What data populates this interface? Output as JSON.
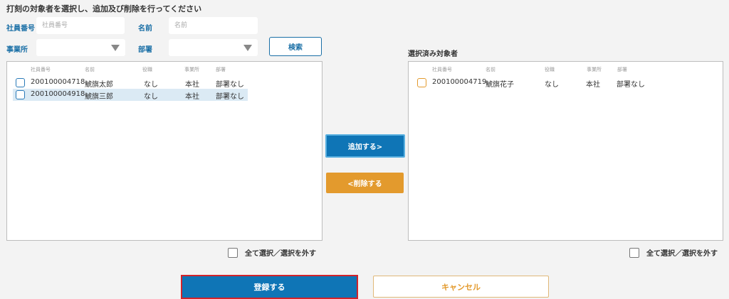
{
  "instruction": "打刻の対象者を選択し、追加及び削除を行ってください",
  "filters": {
    "employee_no_label": "社員番号",
    "employee_no_placeholder": "社員番号",
    "name_label": "名前",
    "name_placeholder": "名前",
    "office_label": "事業所",
    "office_value": "",
    "department_label": "部署",
    "department_value": "",
    "search_label": "検索"
  },
  "left_panel": {
    "columns": [
      "社員番号",
      "名前",
      "役職",
      "事業所",
      "部署"
    ],
    "rows": [
      {
        "employee_no": "200100004718",
        "name": "鯱旗太郎",
        "position": "なし",
        "office": "本社",
        "department": "部署なし",
        "checked": false,
        "highlighted": false
      },
      {
        "employee_no": "200100004918",
        "name": "鯱旗三郎",
        "position": "なし",
        "office": "本社",
        "department": "部署なし",
        "checked": false,
        "highlighted": true
      }
    ],
    "select_all_label": "全て選択／選択を外す"
  },
  "right_panel": {
    "title": "選択済み対象者",
    "columns": [
      "社員番号",
      "名前",
      "役職",
      "事業所",
      "部署"
    ],
    "rows": [
      {
        "employee_no": "200100004719",
        "name": "鯱旗花子",
        "position": "なし",
        "office": "本社",
        "department": "部署なし",
        "checked": false
      }
    ],
    "select_all_label": "全て選択／選択を外す"
  },
  "actions": {
    "add_label": "追加する>",
    "remove_label": "<削除する",
    "register_label": "登録する",
    "cancel_label": "キャンセル"
  },
  "colors": {
    "primary": "#0f75b6",
    "accent": "#e39a2d",
    "highlight_row": "#dbeaf4",
    "focus_border": "#d2232a"
  }
}
